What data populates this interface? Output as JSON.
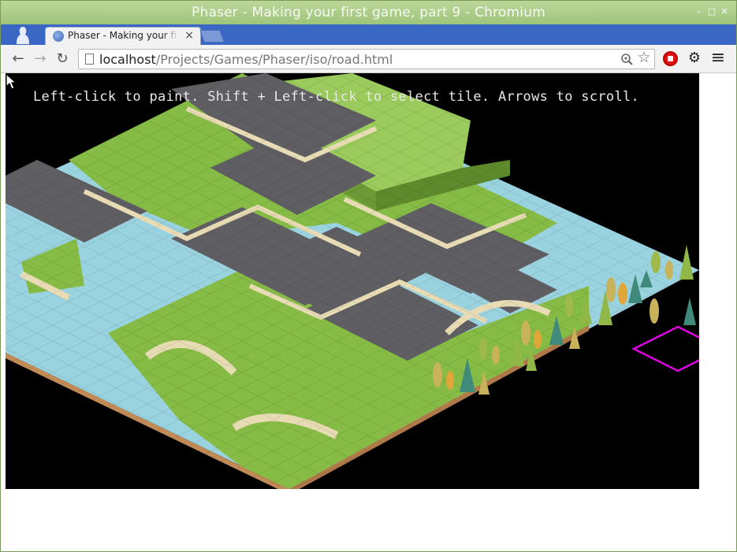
{
  "window": {
    "title": "Phaser - Making your first game, part 9 - Chromium",
    "controls": {
      "minimize": "–",
      "maximize": "□",
      "close": "✕"
    }
  },
  "tabs": [
    {
      "label": "Phaser - Making your first game, part 9",
      "close": "×",
      "icon": "globe-icon"
    }
  ],
  "toolbar": {
    "back": "←",
    "forward": "→",
    "reload": "↻",
    "url_host": "localhost",
    "url_path": "/Projects/Games/Phaser/iso/road.html",
    "zoom_icon": "magnifier-icon",
    "bookmark": "☆",
    "settings": "⚙",
    "menu": "≡"
  },
  "game": {
    "instructions": "Left-click to paint. Shift + Left-click to select tile. Arrows to scroll.",
    "colors": {
      "grass": "#8bbf4a",
      "water": "#9fd4e2",
      "road": "#5f5f63",
      "sand": "#e8dcb5",
      "cursor": "#e000e0",
      "background": "#000000"
    }
  }
}
